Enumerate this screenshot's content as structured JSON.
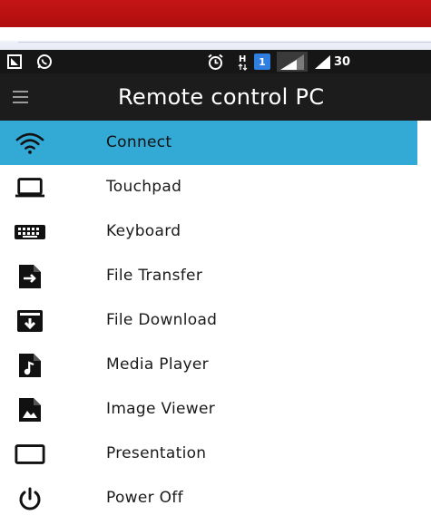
{
  "app": {
    "title": "Remote control PC"
  },
  "status_bar": {
    "time_partial": "30",
    "sim_badge": "1"
  },
  "menu": {
    "items": [
      {
        "label": "Connect",
        "icon": "wifi-icon",
        "active": true
      },
      {
        "label": "Touchpad",
        "icon": "laptop-icon",
        "active": false
      },
      {
        "label": "Keyboard",
        "icon": "keyboard-icon",
        "active": false
      },
      {
        "label": "File Transfer",
        "icon": "file-transfer-icon",
        "active": false
      },
      {
        "label": "File Download",
        "icon": "file-download-icon",
        "active": false
      },
      {
        "label": "Media Player",
        "icon": "music-file-icon",
        "active": false
      },
      {
        "label": "Image Viewer",
        "icon": "image-file-icon",
        "active": false
      },
      {
        "label": "Presentation",
        "icon": "presentation-icon",
        "active": false
      },
      {
        "label": "Power Off",
        "icon": "power-icon",
        "active": false
      }
    ]
  },
  "colors": {
    "accent": "#33a9d6",
    "appbar": "#1c1c1c",
    "statusbar": "#161616",
    "browser_bar": "#c41515"
  }
}
